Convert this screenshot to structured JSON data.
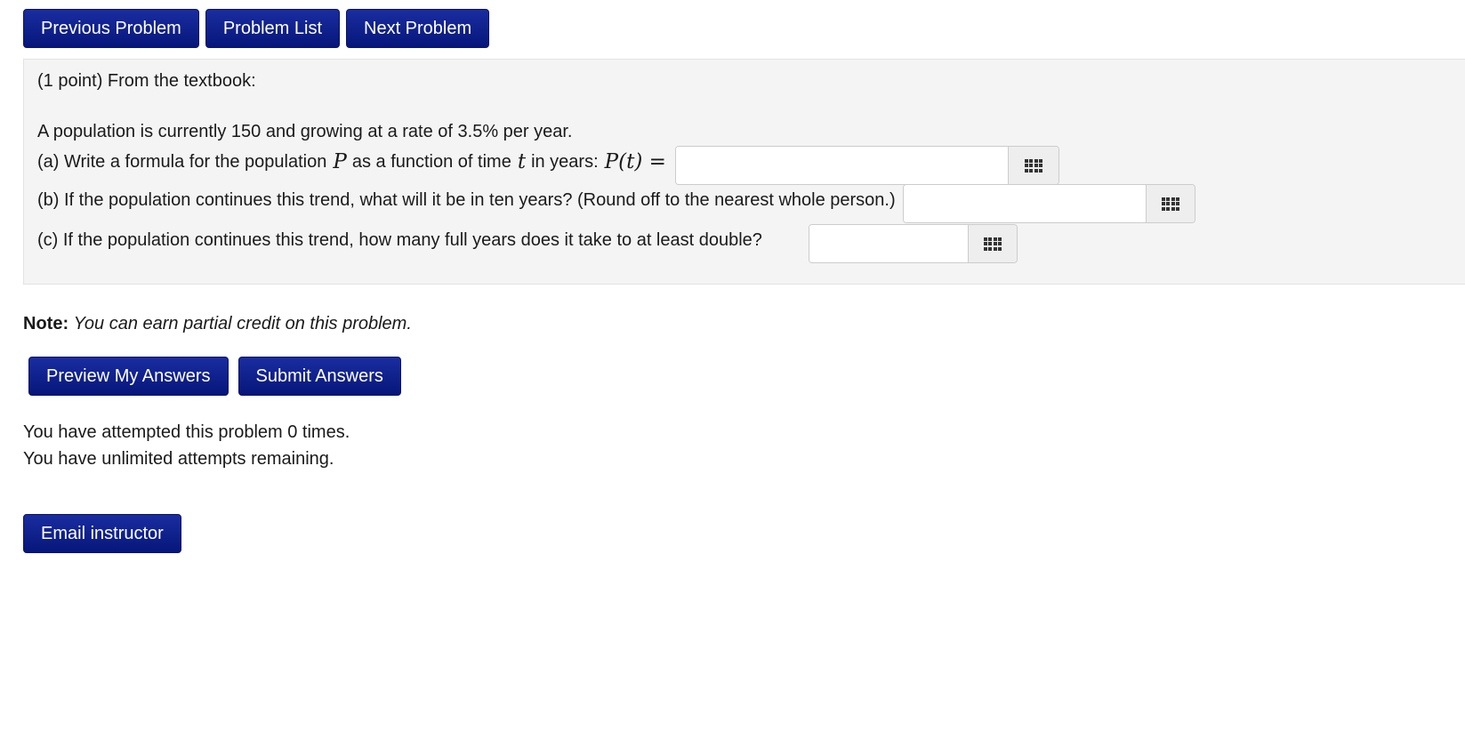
{
  "nav": {
    "previous": "Previous Problem",
    "list": "Problem List",
    "next": "Next Problem"
  },
  "problem": {
    "intro": "(1 point) From the textbook:",
    "statement": "A population is currently 150 and growing at a rate of 3.5% per year.",
    "part_a": {
      "text_before": "(a) Write a formula for the population",
      "var_p": "P",
      "text_mid": "as a function of time",
      "var_t": "t",
      "text_after": "in years:",
      "formula": "P(t) =",
      "answer": ""
    },
    "part_b": {
      "text": "(b) If the population continues this trend, what will it be in ten years? (Round off to the nearest whole person.)",
      "answer": ""
    },
    "part_c": {
      "text": "(c) If the population continues this trend, how many full years does it take to at least double?",
      "answer": ""
    }
  },
  "note": {
    "label": "Note:",
    "text": "You can earn partial credit on this problem."
  },
  "actions": {
    "preview": "Preview My Answers",
    "submit": "Submit Answers"
  },
  "status": {
    "attempted": "You have attempted this problem 0 times.",
    "remaining": "You have unlimited attempts remaining."
  },
  "email": "Email instructor",
  "colors": {
    "button_bg": "#0e1f8c",
    "problem_bg": "#f4f4f4"
  },
  "icons": {
    "equation_editor": "grid-icon"
  }
}
